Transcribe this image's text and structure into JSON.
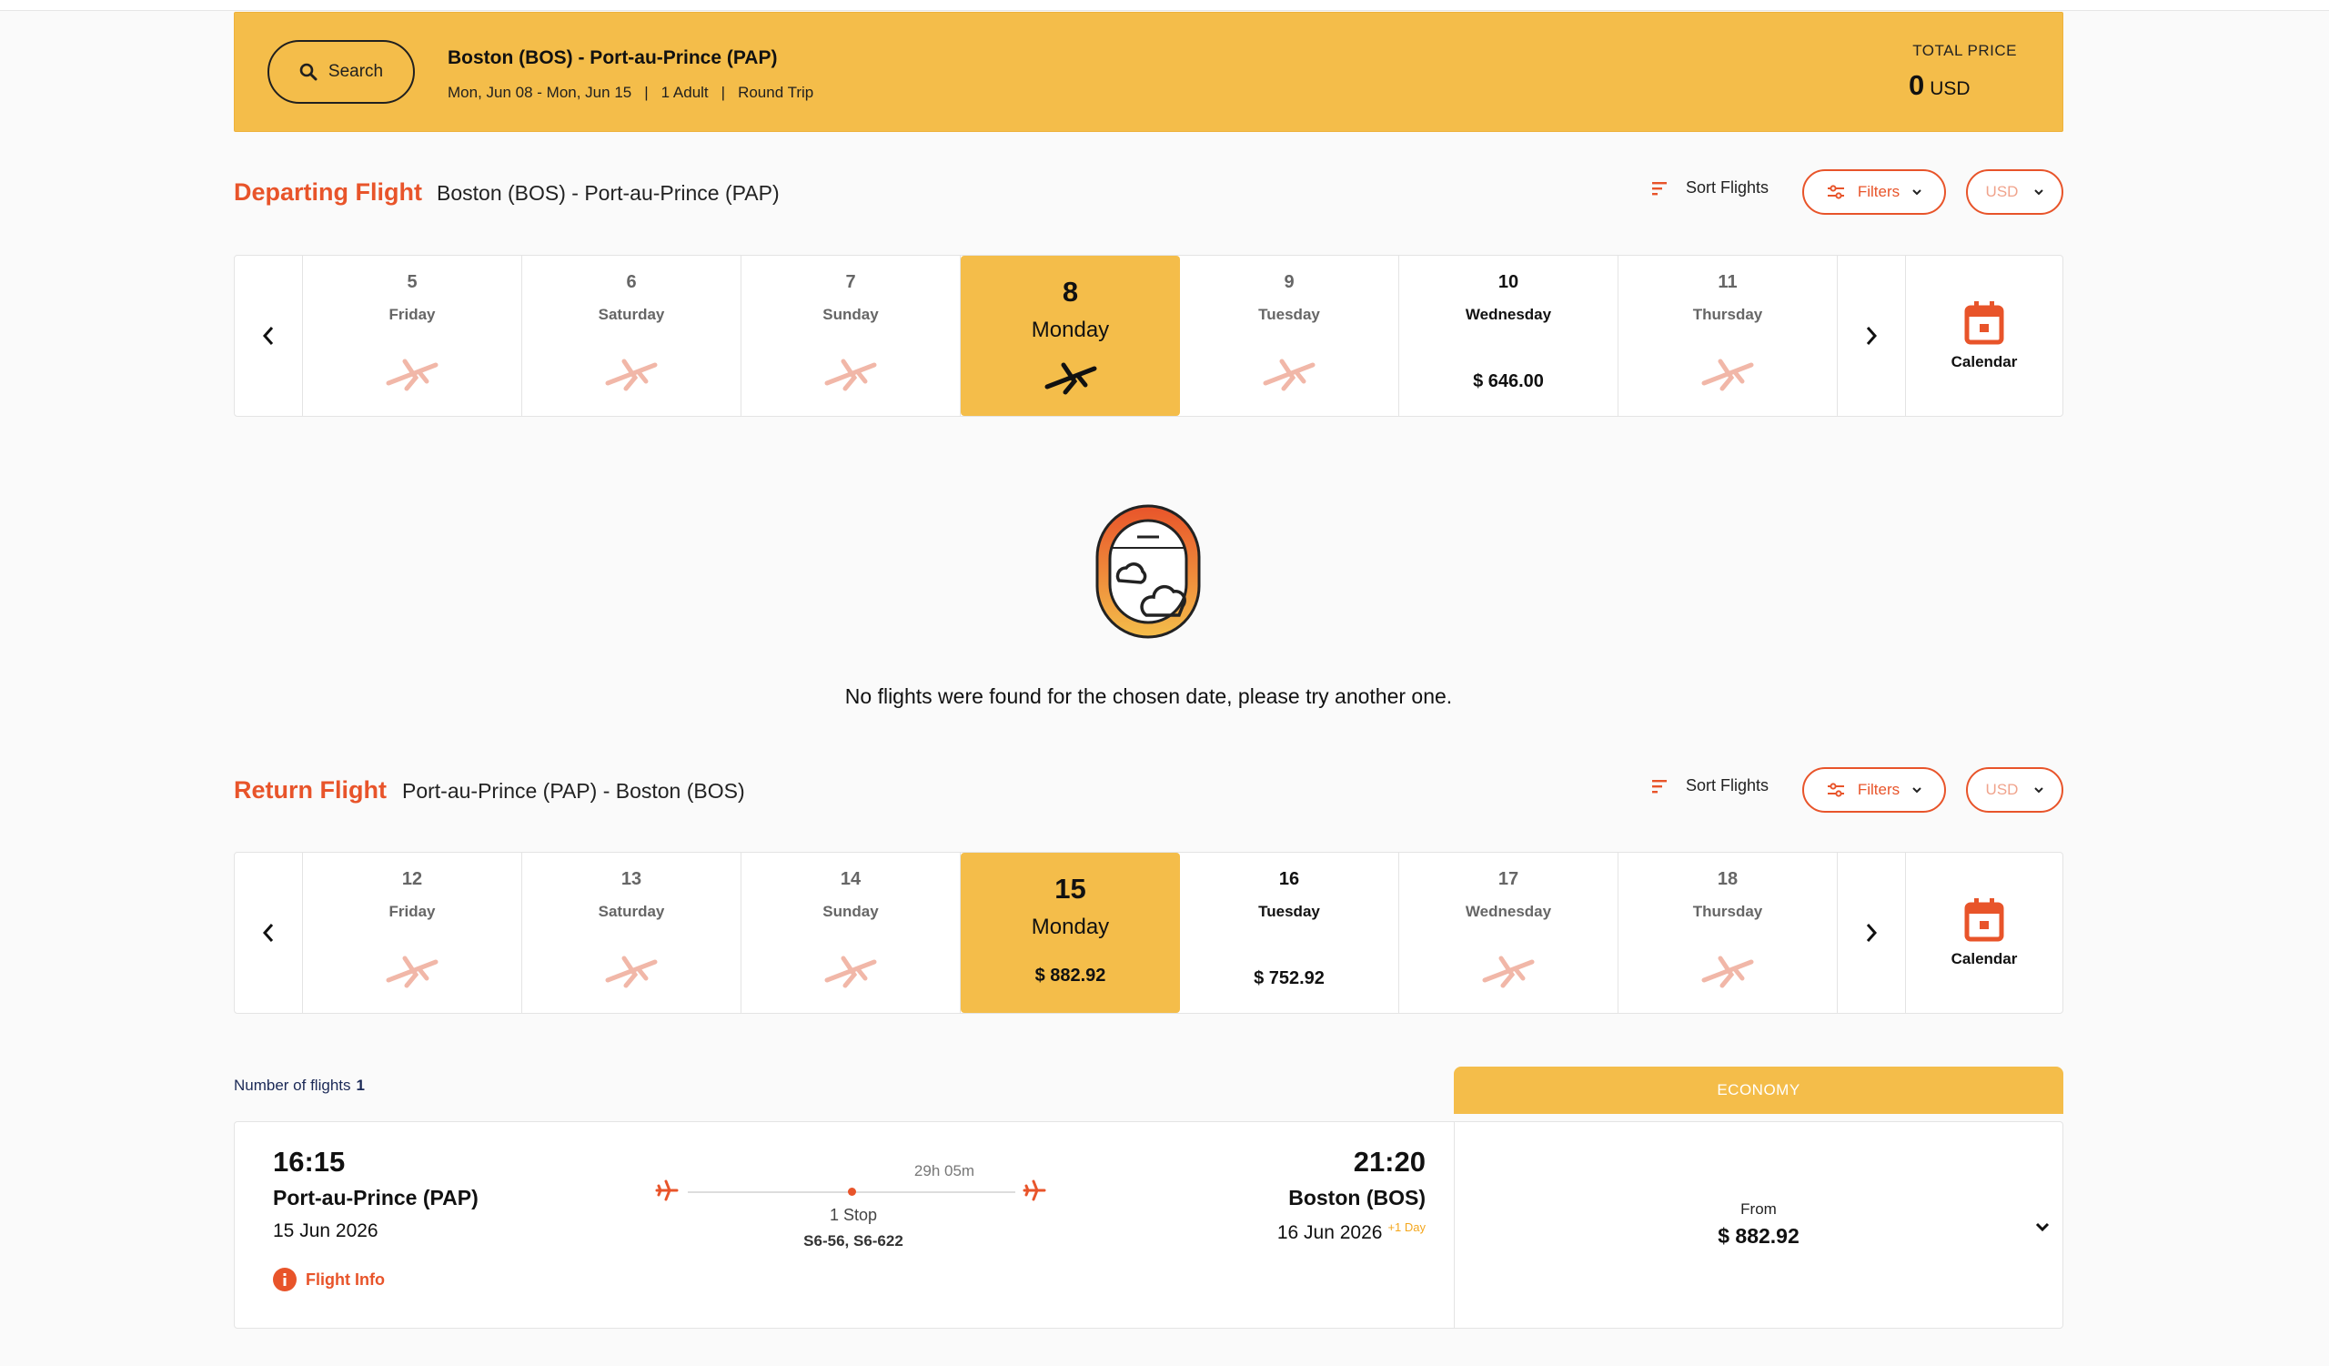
{
  "summary": {
    "search_label": "Search",
    "route": "Boston (BOS) - Port-au-Prince (PAP)",
    "dates": "Mon, Jun 08 - Mon, Jun 15",
    "passengers": "1 Adult",
    "trip_type": "Round Trip",
    "sep": "|",
    "total_price_label": "TOTAL PRICE",
    "total_price_value": "0",
    "total_price_currency": "USD"
  },
  "departing": {
    "title": "Departing Flight",
    "route": "Boston (BOS) - Port-au-Prince (PAP)",
    "sort_label": "Sort Flights",
    "filters_label": "Filters",
    "currency": "USD",
    "calendar_label": "Calendar",
    "days": [
      {
        "num": "5",
        "weekday": "Friday",
        "price": ""
      },
      {
        "num": "6",
        "weekday": "Saturday",
        "price": ""
      },
      {
        "num": "7",
        "weekday": "Sunday",
        "price": ""
      },
      {
        "num": "8",
        "weekday": "Monday",
        "price": ""
      },
      {
        "num": "9",
        "weekday": "Tuesday",
        "price": ""
      },
      {
        "num": "10",
        "weekday": "Wednesday",
        "price": "$ 646.00"
      },
      {
        "num": "11",
        "weekday": "Thursday",
        "price": ""
      }
    ],
    "empty_message": "No flights were found for the chosen date, please try another one."
  },
  "return": {
    "title": "Return Flight",
    "route": "Port-au-Prince (PAP) - Boston (BOS)",
    "sort_label": "Sort Flights",
    "filters_label": "Filters",
    "currency": "USD",
    "calendar_label": "Calendar",
    "days": [
      {
        "num": "12",
        "weekday": "Friday",
        "price": ""
      },
      {
        "num": "13",
        "weekday": "Saturday",
        "price": ""
      },
      {
        "num": "14",
        "weekday": "Sunday",
        "price": ""
      },
      {
        "num": "15",
        "weekday": "Monday",
        "price": "$ 882.92"
      },
      {
        "num": "16",
        "weekday": "Tuesday",
        "price": "$ 752.92"
      },
      {
        "num": "17",
        "weekday": "Wednesday",
        "price": ""
      },
      {
        "num": "18",
        "weekday": "Thursday",
        "price": ""
      }
    ]
  },
  "results": {
    "count_label": "Number of flights",
    "count": "1",
    "cabin_label": "ECONOMY",
    "flight": {
      "dep_time": "16:15",
      "dep_city": "Port-au-Prince (PAP)",
      "dep_date": "15 Jun 2026",
      "arr_time": "21:20",
      "arr_city": "Boston (BOS)",
      "arr_date": "16 Jun 2026",
      "arr_day_offset": "+1 Day",
      "duration": "29h 05m",
      "stops": "1 Stop",
      "flight_numbers": "S6-56, S6-622",
      "info_label": "Flight Info",
      "from_label": "From",
      "from_price": "$ 882.92"
    }
  },
  "colors": {
    "accent": "#e8542a",
    "brand_yellow": "#f4bd4a"
  }
}
